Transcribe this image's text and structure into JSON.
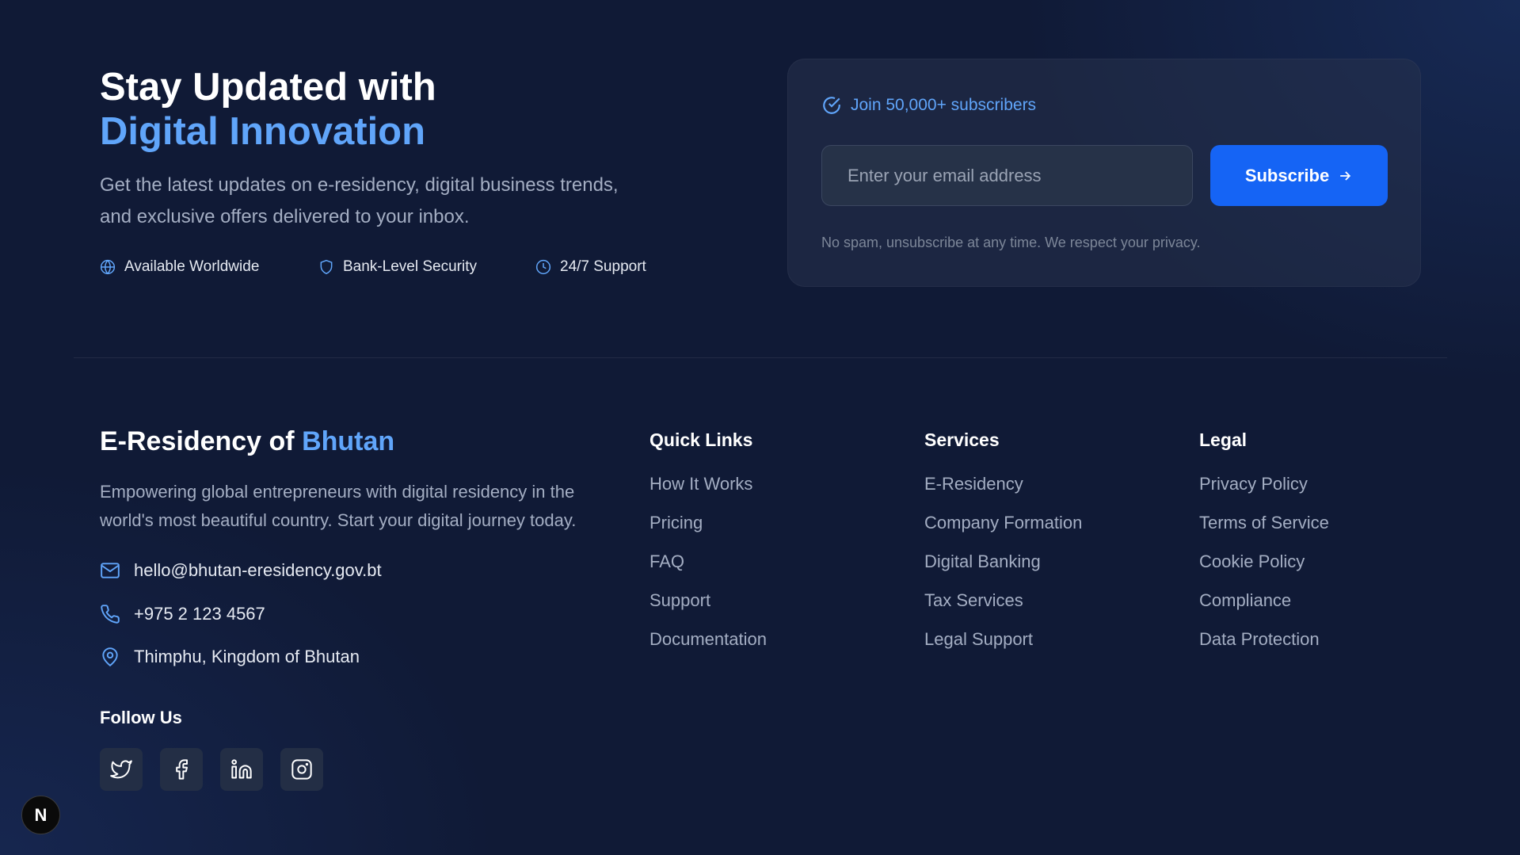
{
  "hero": {
    "title_line1": "Stay Updated with",
    "title_line2": "Digital Innovation",
    "description": "Get the latest updates on e-residency, digital business trends, and exclusive offers delivered to your inbox.",
    "features": [
      {
        "label": "Available Worldwide",
        "icon": "globe-icon"
      },
      {
        "label": "Bank-Level Security",
        "icon": "shield-icon"
      },
      {
        "label": "24/7 Support",
        "icon": "clock-icon"
      }
    ]
  },
  "newsletter": {
    "badge": "Join 50,000+ subscribers",
    "email_placeholder": "Enter your email address",
    "email_value": "",
    "subscribe_label": "Subscribe",
    "privacy_note": "No spam, unsubscribe at any time. We respect your privacy."
  },
  "footer": {
    "brand_prefix": "E-Residency of ",
    "brand_accent": "Bhutan",
    "description": "Empowering global entrepreneurs with digital residency in the world's most beautiful country. Start your digital journey today.",
    "email": "hello@bhutan-eresidency.gov.bt",
    "phone": "+975 2 123 4567",
    "address": "Thimphu, Kingdom of Bhutan",
    "follow_label": "Follow Us",
    "socials": [
      "twitter-icon",
      "facebook-icon",
      "linkedin-icon",
      "instagram-icon"
    ],
    "columns": [
      {
        "title": "Quick Links",
        "links": [
          "How It Works",
          "Pricing",
          "FAQ",
          "Support",
          "Documentation"
        ]
      },
      {
        "title": "Services",
        "links": [
          "E-Residency",
          "Company Formation",
          "Digital Banking",
          "Tax Services",
          "Legal Support"
        ]
      },
      {
        "title": "Legal",
        "links": [
          "Privacy Policy",
          "Terms of Service",
          "Cookie Policy",
          "Compliance",
          "Data Protection"
        ]
      }
    ]
  },
  "dev_badge": "N",
  "colors": {
    "accent": "#60a5fa",
    "button": "#1564f5",
    "background": "#101a36"
  }
}
